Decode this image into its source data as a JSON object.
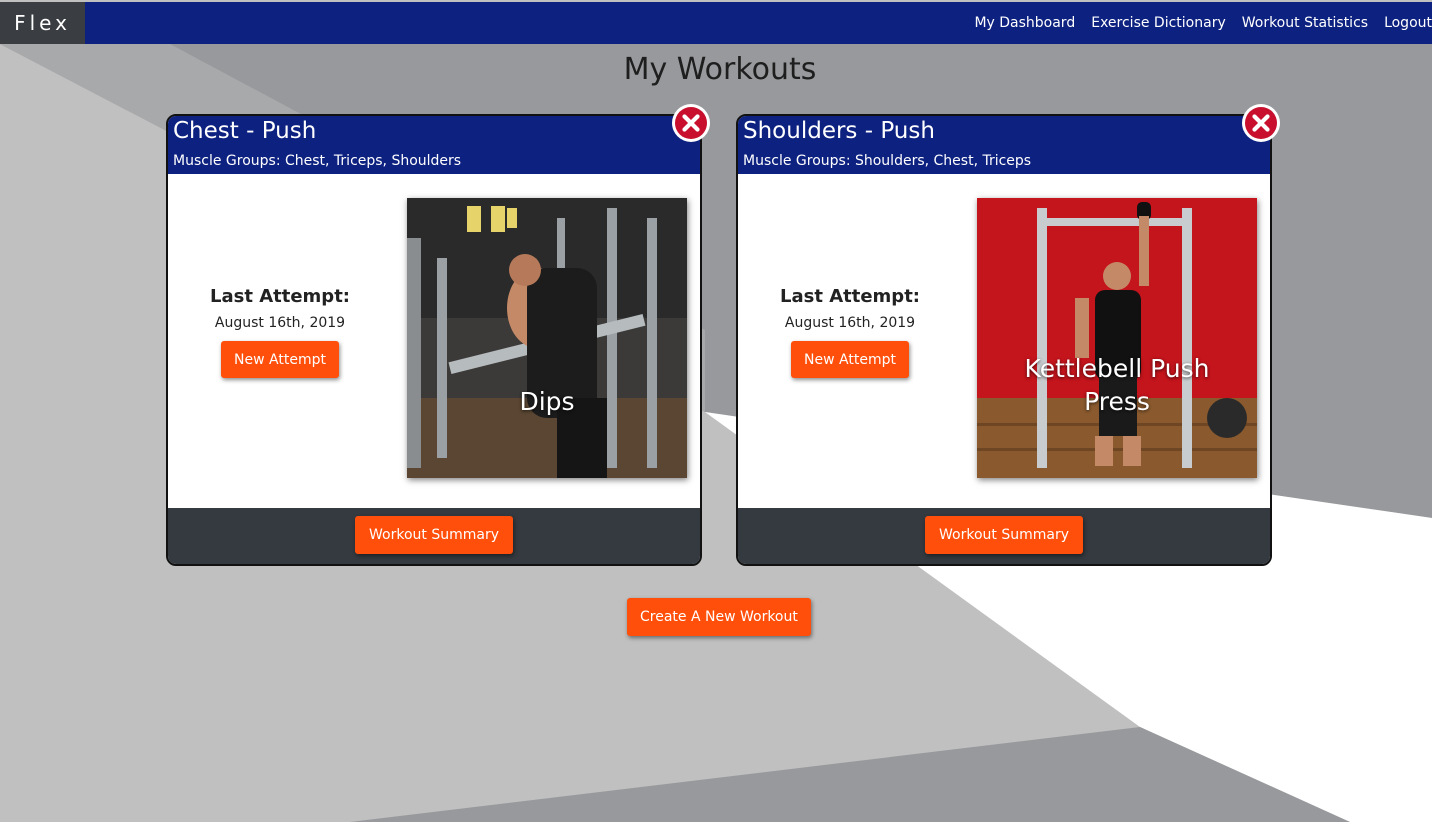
{
  "app": {
    "brand": "Flex"
  },
  "nav": {
    "dashboard": "My Dashboard",
    "dictionary": "Exercise Dictionary",
    "statistics": "Workout Statistics",
    "logout": "Logout"
  },
  "page": {
    "title": "My Workouts"
  },
  "workouts": [
    {
      "title": "Chest - Push",
      "muscle_groups": "Muscle Groups: Chest, Triceps, Shoulders",
      "last_attempt_label": "Last Attempt:",
      "last_attempt_date": "August 16th, 2019",
      "new_attempt_label": "New Attempt",
      "exercise_name": "Dips",
      "summary_label": "Workout Summary"
    },
    {
      "title": "Shoulders - Push",
      "muscle_groups": "Muscle Groups: Shoulders, Chest, Triceps",
      "last_attempt_label": "Last Attempt:",
      "last_attempt_date": "August 16th, 2019",
      "new_attempt_label": "New Attempt",
      "exercise_name": "Kettlebell Push Press",
      "summary_label": "Workout Summary"
    }
  ],
  "create_label": "Create A New Workout",
  "colors": {
    "navbar": "#0d2180",
    "brand_bg": "#3a3d41",
    "accent": "#ff4f0a",
    "card_footer": "#343a40",
    "delete": "#c8102e",
    "bg_dark": "#97999c",
    "bg_light": "#c0c0c0"
  },
  "icons": {
    "delete": "close-circle-icon"
  }
}
